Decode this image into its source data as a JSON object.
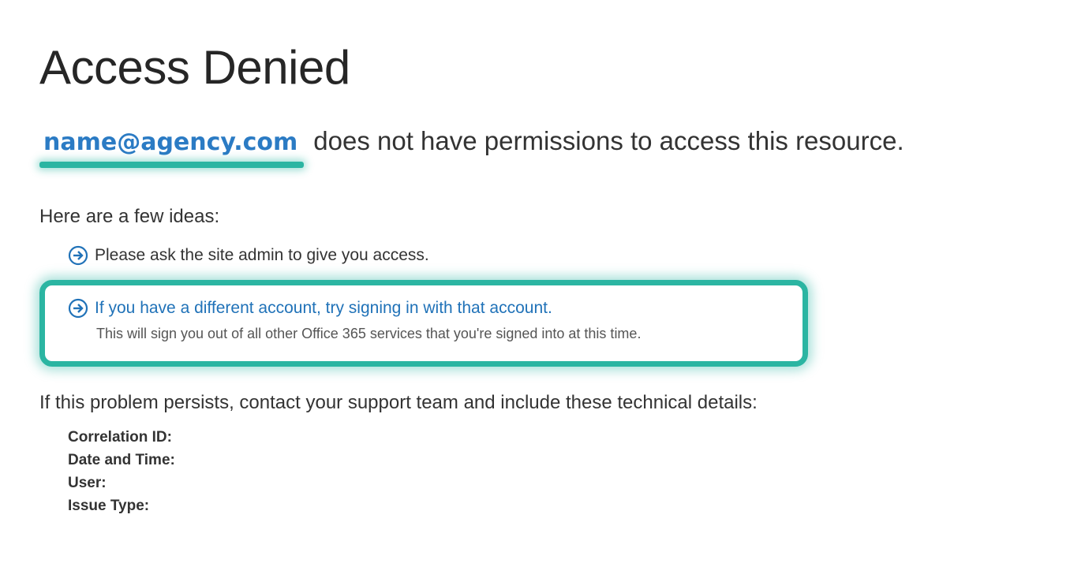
{
  "page": {
    "title": "Access Denied"
  },
  "account": {
    "email": "name@agency.com",
    "message": "does not have permissions to access this resource."
  },
  "ideas": {
    "heading": "Here are a few ideas:",
    "items": [
      {
        "text": "Please ask the site admin to give you access.",
        "icon": "arrow-circle-right-icon"
      },
      {
        "text": "If you have a different account, try signing in with that account.",
        "subtext": "This will sign you out of all other Office 365 services that you're signed into at this time.",
        "icon": "arrow-circle-right-icon"
      }
    ]
  },
  "support": {
    "message": "If this problem persists, contact your support team and include these technical details:",
    "details": [
      {
        "label": "Correlation ID:"
      },
      {
        "label": "Date and Time:"
      },
      {
        "label": "User:"
      },
      {
        "label": "Issue Type:"
      }
    ]
  },
  "colors": {
    "highlight": "#2bb5a2",
    "link": "#2072b8",
    "email": "#2b7bc4"
  }
}
